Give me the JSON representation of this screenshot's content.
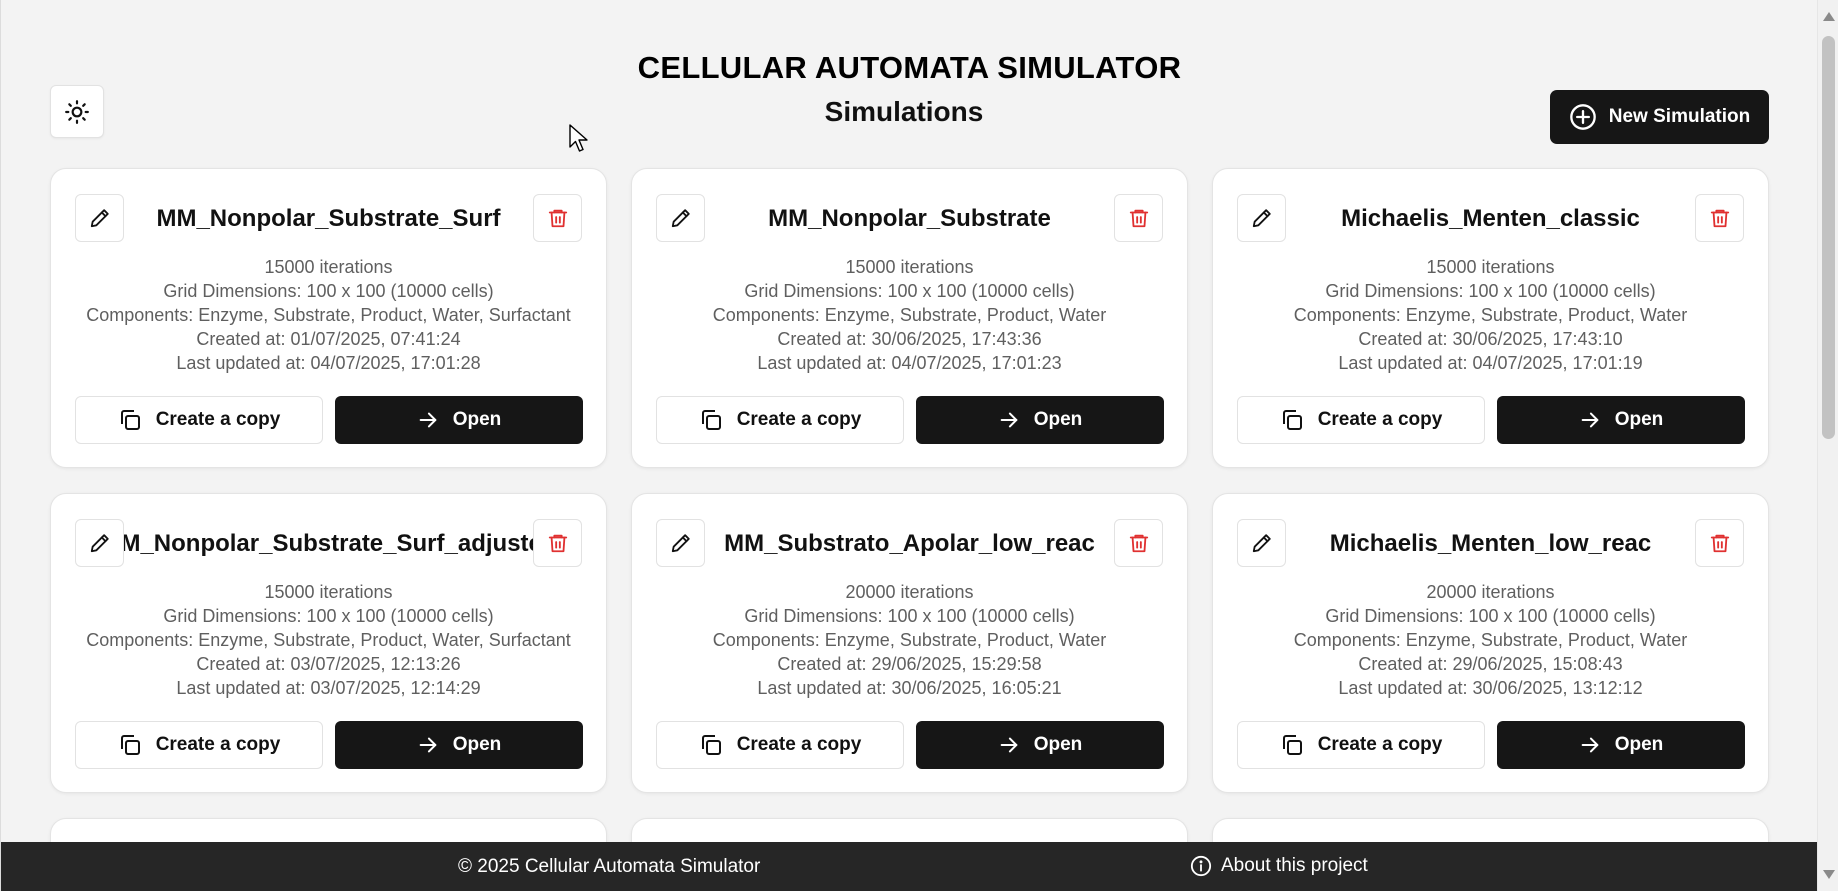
{
  "header": {
    "app_title": "CELLULAR AUTOMATA SIMULATOR",
    "page_title": "Simulations",
    "new_button_label": "New Simulation"
  },
  "card_buttons": {
    "copy_label": "Create a copy",
    "open_label": "Open"
  },
  "simulations": [
    {
      "name": "MM_Nonpolar_Substrate_Surf",
      "iterations": "15000 iterations",
      "grid": "Grid Dimensions: 100 x 100 (10000 cells)",
      "components": "Components: Enzyme, Substrate, Product, Water, Surfactant",
      "created": "Created at: 01/07/2025, 07:41:24",
      "updated": "Last updated at: 04/07/2025, 17:01:28"
    },
    {
      "name": "MM_Nonpolar_Substrate",
      "iterations": "15000 iterations",
      "grid": "Grid Dimensions: 100 x 100 (10000 cells)",
      "components": "Components: Enzyme, Substrate, Product, Water",
      "created": "Created at: 30/06/2025, 17:43:36",
      "updated": "Last updated at: 04/07/2025, 17:01:23"
    },
    {
      "name": "Michaelis_Menten_classic",
      "iterations": "15000 iterations",
      "grid": "Grid Dimensions: 100 x 100 (10000 cells)",
      "components": "Components: Enzyme, Substrate, Product, Water",
      "created": "Created at: 30/06/2025, 17:43:10",
      "updated": "Last updated at: 04/07/2025, 17:01:19"
    },
    {
      "name": "MM_Nonpolar_Substrate_Surf_adjusted",
      "iterations": "15000 iterations",
      "grid": "Grid Dimensions: 100 x 100 (10000 cells)",
      "components": "Components: Enzyme, Substrate, Product, Water, Surfactant",
      "created": "Created at: 03/07/2025, 12:13:26",
      "updated": "Last updated at: 03/07/2025, 12:14:29"
    },
    {
      "name": "MM_Substrato_Apolar_low_reac",
      "iterations": "20000 iterations",
      "grid": "Grid Dimensions: 100 x 100 (10000 cells)",
      "components": "Components: Enzyme, Substrate, Product, Water",
      "created": "Created at: 29/06/2025, 15:29:58",
      "updated": "Last updated at: 30/06/2025, 16:05:21"
    },
    {
      "name": "Michaelis_Menten_low_reac",
      "iterations": "20000 iterations",
      "grid": "Grid Dimensions: 100 x 100 (10000 cells)",
      "components": "Components: Enzyme, Substrate, Product, Water",
      "created": "Created at: 29/06/2025, 15:08:43",
      "updated": "Last updated at: 30/06/2025, 13:12:12"
    }
  ],
  "footer": {
    "copyright": "© 2025 Cellular Automata Simulator",
    "about": "About this project"
  },
  "icons": {
    "theme": "sun-icon",
    "new": "plus-circle-icon",
    "edit": "pencil-icon",
    "delete": "trash-icon",
    "copy": "copy-icon",
    "open": "arrow-right-icon",
    "about": "info-icon"
  },
  "colors": {
    "background": "#f3f3f3",
    "primary_button": "#161616",
    "delete_icon": "#e03131",
    "footer": "#262626",
    "muted_text": "#5f5f5f"
  }
}
